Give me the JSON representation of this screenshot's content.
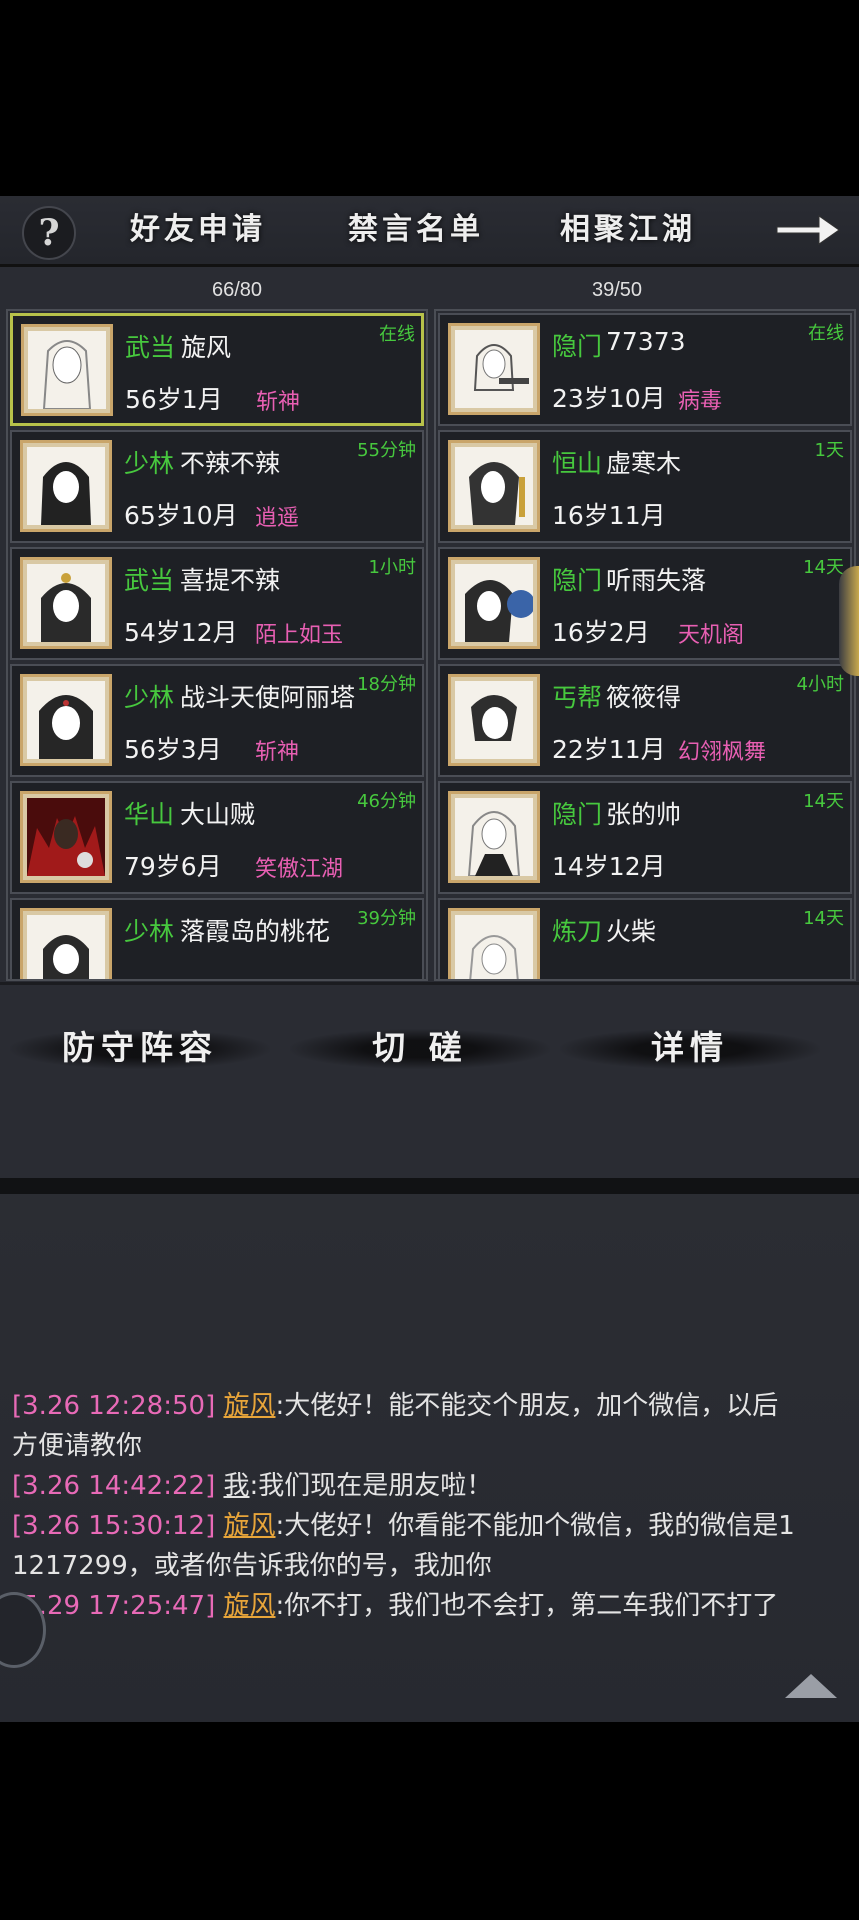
{
  "header": {
    "help_label": "?",
    "tabs": [
      "好友申请",
      "禁言名单",
      "相聚江湖"
    ]
  },
  "left_list": {
    "count": "66/80",
    "rows": [
      {
        "sect": "武当",
        "name": "旋风",
        "age": "56岁1月",
        "skill": "斩神",
        "status": "在线"
      },
      {
        "sect": "少林",
        "name": "不辣不辣",
        "age": "65岁10月",
        "skill": "逍遥",
        "status": "55分钟"
      },
      {
        "sect": "武当",
        "name": "喜提不辣",
        "age": "54岁12月",
        "skill": "陌上如玉",
        "status": "1小时"
      },
      {
        "sect": "少林",
        "name": "战斗天使阿丽塔",
        "age": "56岁3月",
        "skill": "斩神",
        "status": "18分钟"
      },
      {
        "sect": "华山",
        "name": "大山贼",
        "age": "79岁6月",
        "skill": "笑傲江湖",
        "status": "46分钟"
      },
      {
        "sect": "少林",
        "name": "落霞岛的桃花",
        "age": "",
        "skill": "",
        "status": "39分钟"
      }
    ]
  },
  "right_list": {
    "count": "39/50",
    "rows": [
      {
        "sect": "隐门",
        "name": "77373",
        "age": "23岁10月",
        "skill": "病毒",
        "status": "在线"
      },
      {
        "sect": "恒山",
        "name": "虚寒木",
        "age": "16岁11月",
        "skill": "",
        "status": "1天"
      },
      {
        "sect": "隐门",
        "name": "听雨失落",
        "age": "16岁2月",
        "skill": "天机阁",
        "status": "14天"
      },
      {
        "sect": "丐帮",
        "name": "筱筱得",
        "age": "22岁11月",
        "skill": "幻翎枫舞",
        "status": "4小时"
      },
      {
        "sect": "隐门",
        "name": "张的帅",
        "age": "14岁12月",
        "skill": "",
        "status": "14天"
      },
      {
        "sect": "炼刀",
        "name": "火柴",
        "age": "",
        "skill": "",
        "status": "14天"
      }
    ]
  },
  "actions": [
    "防守阵容",
    "切 磋",
    "详情"
  ],
  "chat": [
    {
      "ts": "[3.26 12:28:50]",
      "who": "旋风",
      "text": ":大佬好！能不能交个朋友，加个微信，以后",
      "text2": "方便请教你"
    },
    {
      "ts": "[3.26 14:42:22]",
      "who": "我",
      "text": ":我们现在是朋友啦！"
    },
    {
      "ts": "[3.26 15:30:12]",
      "who": "旋风",
      "text": ":大佬好！你看能不能加个微信，我的微信是1",
      "text2": "1217299，或者你告诉我你的号，我加你"
    },
    {
      "ts": "[5.29 17:25:47]",
      "who": "旋风",
      "text": ":你不打，我们也不会打，第二车我们不打了"
    }
  ],
  "colors": {
    "sect_green": "#47c83e",
    "skill_pink": "#e85fb3",
    "timestamp_pink": "#e86ab7",
    "speaker_orange": "#e8a53a",
    "selected_border": "#b8c24a"
  }
}
